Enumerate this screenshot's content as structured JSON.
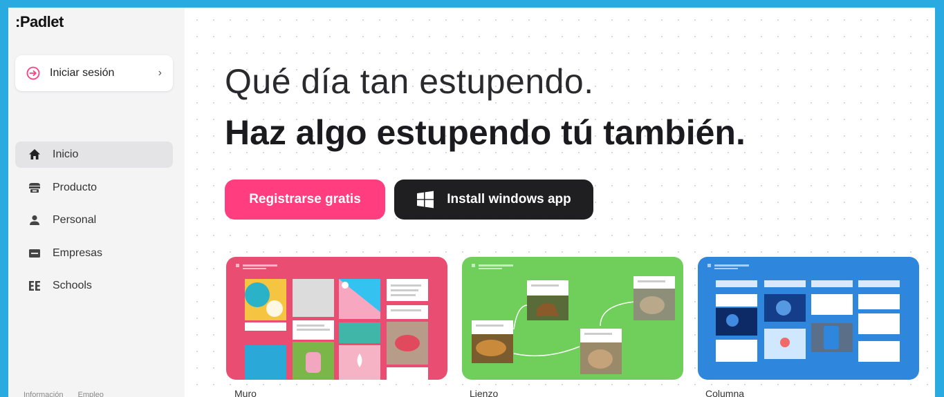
{
  "sidebar": {
    "logo": ":Padlet",
    "signin_label": "Iniciar sesión",
    "items": [
      {
        "label": "Inicio",
        "icon": "home-icon"
      },
      {
        "label": "Producto",
        "icon": "store-icon"
      },
      {
        "label": "Personal",
        "icon": "person-icon"
      },
      {
        "label": "Empresas",
        "icon": "business-icon"
      },
      {
        "label": "Schools",
        "icon": "schools-icon"
      }
    ],
    "footer": [
      "Información",
      "Empleo"
    ]
  },
  "hero": {
    "line1": "Qué día tan estupendo.",
    "line2": "Haz algo estupendo tú también."
  },
  "buttons": {
    "register": "Registrarse gratis",
    "install": "Install windows app"
  },
  "cards": [
    {
      "caption": "Muro",
      "color": "#e94e72"
    },
    {
      "caption": "Lienzo",
      "color": "#6fcf5a"
    },
    {
      "caption": "Columna",
      "color": "#2f86dd"
    }
  ],
  "colors": {
    "accent": "#ff3d7f",
    "dark_button": "#1f1f22",
    "frame": "#29abe2"
  }
}
